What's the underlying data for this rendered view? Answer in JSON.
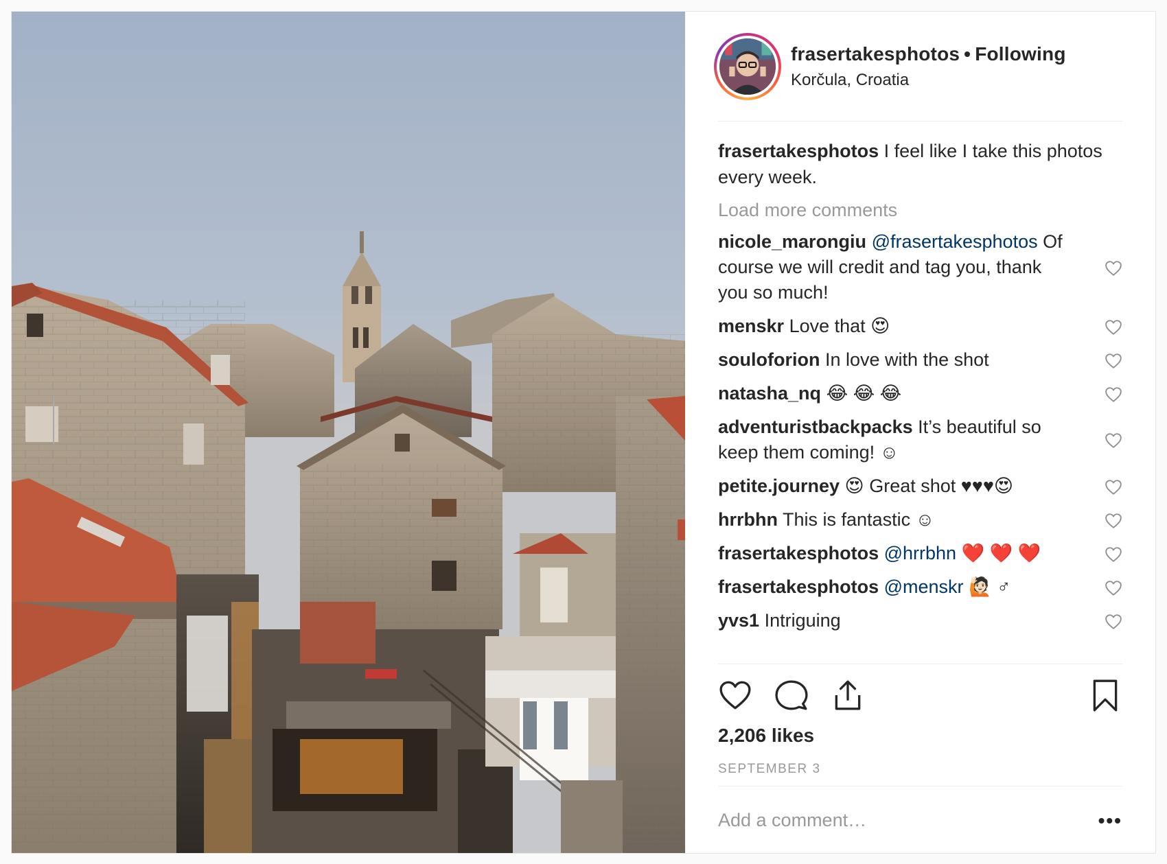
{
  "post": {
    "username": "frasertakesphotos",
    "follow_status": "Following",
    "location": "Korčula, Croatia",
    "caption": {
      "user": "frasertakesphotos",
      "text": "I feel like I take this photos every week."
    },
    "load_more_label": "Load more comments",
    "comments": [
      {
        "user": "nicole_marongiu",
        "mention": "@frasertakesphotos",
        "text": "Of course we will credit and tag you, thank you so much!"
      },
      {
        "user": "menskr",
        "mention": "",
        "text": "Love that 😍"
      },
      {
        "user": "souloforion",
        "mention": "",
        "text": "In love with the shot"
      },
      {
        "user": "natasha_nq",
        "mention": "",
        "text": "😂 😂 😂"
      },
      {
        "user": "adventuristbackpacks",
        "mention": "",
        "text": "It’s beautiful so keep them coming! ☺"
      },
      {
        "user": "petite.journey",
        "mention": "",
        "text": "😍  Great shot ♥♥♥😍"
      },
      {
        "user": "hrrbhn",
        "mention": "",
        "text": "This is fantastic ☺"
      },
      {
        "user": "frasertakesphotos",
        "mention": "@hrrbhn",
        "text": "❤️ ❤️ ❤️"
      },
      {
        "user": "frasertakesphotos",
        "mention": "@menskr",
        "text": "🙋🏻 ♂"
      },
      {
        "user": "yvs1",
        "mention": "",
        "text": "Intriguing"
      }
    ],
    "likes": "2,206 likes",
    "date": "SEPTEMBER 3",
    "add_comment_placeholder": "Add a comment…",
    "more_label": "•••"
  },
  "icons": {
    "like": "heart-icon",
    "comment": "comment-bubble-icon",
    "share": "share-icon",
    "save": "bookmark-icon",
    "comment_like": "heart-outline-icon"
  },
  "colors": {
    "mention": "#003569",
    "muted": "#999999",
    "text": "#262626"
  }
}
